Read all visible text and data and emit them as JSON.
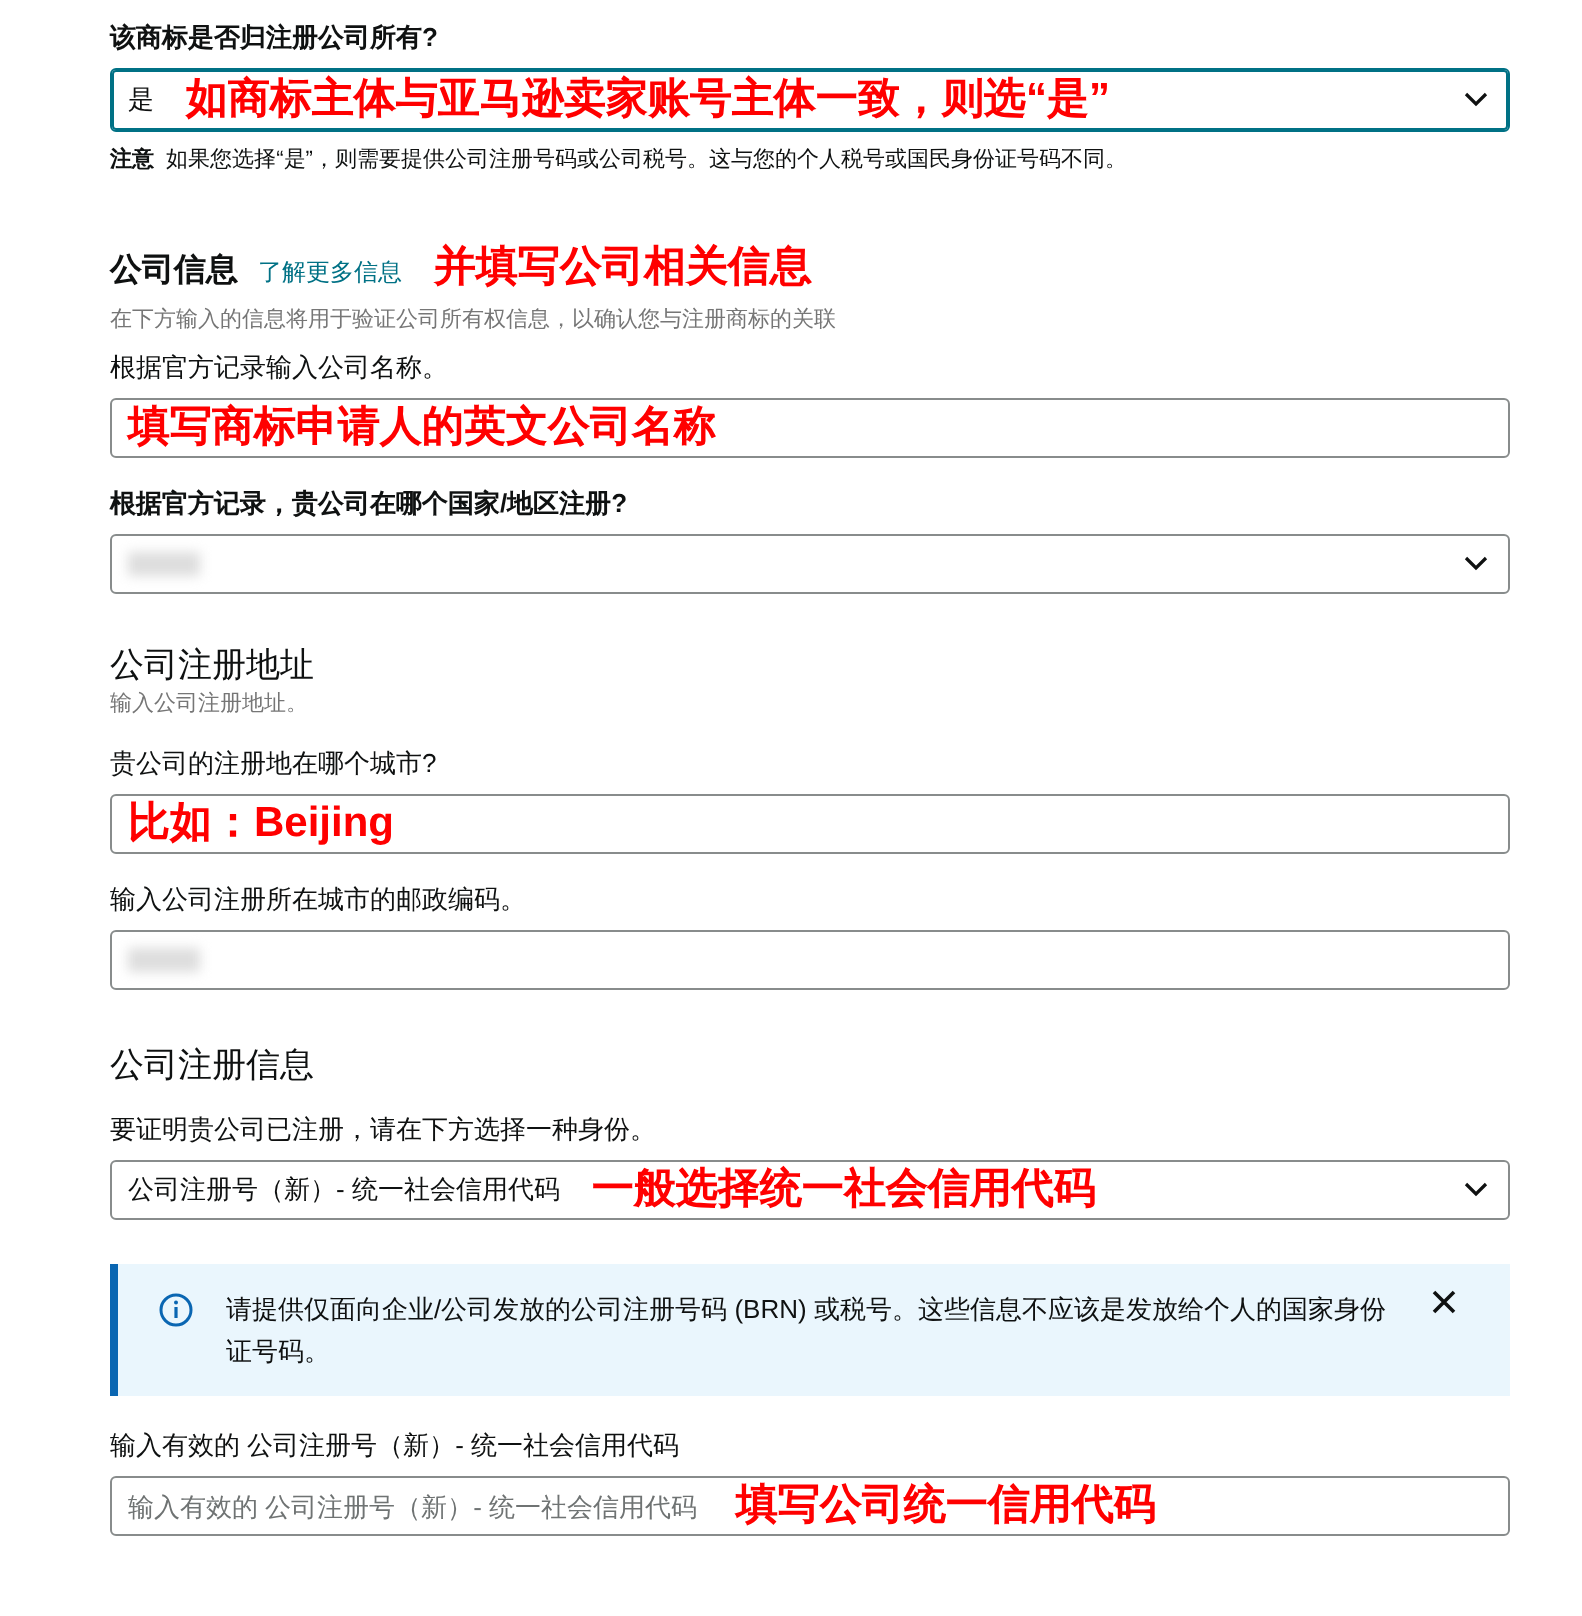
{
  "ownership": {
    "label": "该商标是否归注册公司所有?",
    "select": {
      "value": "是",
      "focused": true,
      "annotation": "如商标主体与亚马逊卖家账号主体一致，则选“是”"
    },
    "note": {
      "title": "注意",
      "text": "如果您选择“是”，则需要提供公司注册号码或公司税号。这与您的个人税号或国民身份证号码不同。"
    }
  },
  "company_info": {
    "title": "公司信息",
    "link": "了解更多信息",
    "annotation": "并填写公司相关信息",
    "description": "在下方输入的信息将用于验证公司所有权信息，以确认您与注册商标的关联",
    "fields": [
      {
        "kind": "input",
        "label": "根据官方记录输入公司名称。",
        "bold": false,
        "annotation": "填写商标申请人的英文公司名称"
      },
      {
        "kind": "select",
        "label": "根据官方记录，贵公司在哪个国家/地区注册?",
        "bold": true,
        "blurred": true
      }
    ]
  },
  "address": {
    "title": "公司注册地址",
    "subtitle": "输入公司注册地址。",
    "fields": [
      {
        "kind": "input",
        "label": "贵公司的注册地在哪个城市?",
        "bold": false,
        "annotation": "比如：Beijing"
      },
      {
        "kind": "input",
        "label": "输入公司注册所在城市的邮政编码。",
        "bold": false,
        "blurred": true
      }
    ]
  },
  "registration": {
    "title": "公司注册信息",
    "fields": [
      {
        "kind": "select",
        "label": "要证明贵公司已注册，请在下方选择一种身份。",
        "bold": false,
        "value": "公司注册号（新）- 统一社会信用代码",
        "annotation": "一般选择统一社会信用代码"
      },
      {
        "kind": "alert",
        "text": "请提供仅面向企业/公司发放的公司注册号码 (BRN) 或税号。这些信息不应该是发放给个人的国家身份证号码。"
      },
      {
        "kind": "input",
        "label": "输入有效的 公司注册号（新）- 统一社会信用代码",
        "bold": false,
        "placeholder": "输入有效的 公司注册号（新）- 统一社会信用代码",
        "annotation": "填写公司统一信用代码"
      }
    ]
  }
}
